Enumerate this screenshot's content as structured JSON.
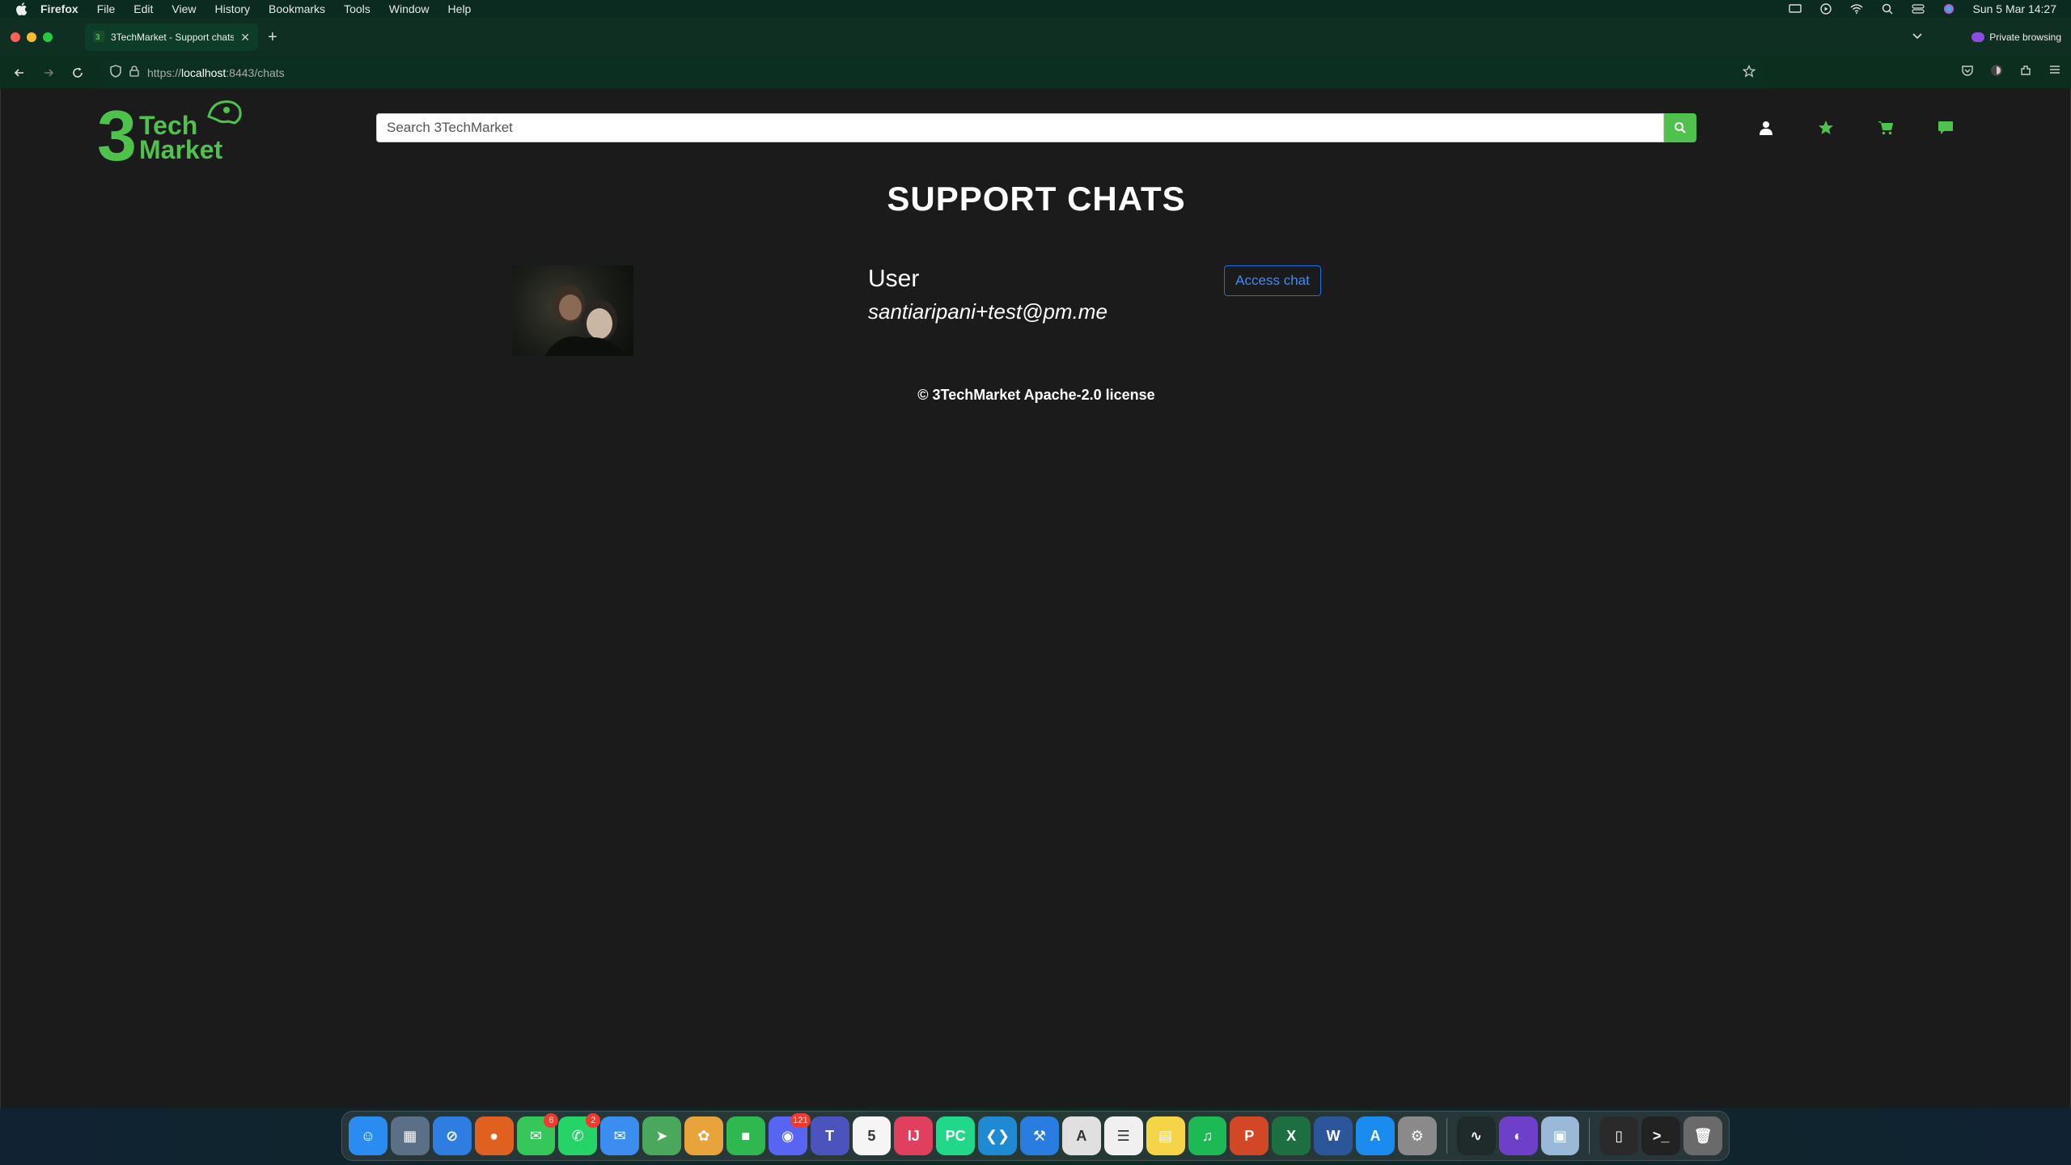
{
  "menubar": {
    "app": "Firefox",
    "items": [
      "File",
      "Edit",
      "View",
      "History",
      "Bookmarks",
      "Tools",
      "Window",
      "Help"
    ],
    "datetime": "Sun 5 Mar  14:27"
  },
  "browser": {
    "tab_title": "3TechMarket - Support chats",
    "private_label": "Private browsing",
    "url_prefix": "https://",
    "url_host": "localhost",
    "url_rest": ":8443/chats"
  },
  "header": {
    "logo_line1": "Tech",
    "logo_line2": "Market",
    "logo_digit": "3",
    "search_placeholder": "Search 3TechMarket",
    "brand_color": "#4ec24d"
  },
  "main": {
    "title": "SUPPORT CHATS",
    "chats": [
      {
        "name": "User",
        "email": "santiaripani+test@pm.me",
        "button": "Access chat"
      }
    ]
  },
  "footer": {
    "text": "© 3TechMarket Apache-2.0 license"
  },
  "dock": {
    "apps": [
      {
        "name": "finder",
        "color": "#2a8cf0",
        "glyph": "☺"
      },
      {
        "name": "launchpad",
        "color": "#5b6f86",
        "glyph": "▦"
      },
      {
        "name": "safari",
        "color": "#2f7de0",
        "glyph": "⊘"
      },
      {
        "name": "firefox",
        "color": "#e0601f",
        "glyph": "●"
      },
      {
        "name": "messages",
        "color": "#35c759",
        "glyph": "✉",
        "badge": "6"
      },
      {
        "name": "whatsapp",
        "color": "#25d366",
        "glyph": "✆",
        "badge": "2"
      },
      {
        "name": "mail",
        "color": "#3b8ef0",
        "glyph": "✉"
      },
      {
        "name": "maps",
        "color": "#4aa85c",
        "glyph": "➤"
      },
      {
        "name": "photos",
        "color": "#e8a33a",
        "glyph": "✿"
      },
      {
        "name": "facetime",
        "color": "#2fb84f",
        "glyph": "■"
      },
      {
        "name": "discord",
        "color": "#5865f2",
        "glyph": "◉",
        "badge": "121"
      },
      {
        "name": "teams",
        "color": "#4b53bc",
        "glyph": "T"
      },
      {
        "name": "calendar",
        "color": "#f5f5f5",
        "glyph": "5"
      },
      {
        "name": "intellij",
        "color": "#e0405e",
        "glyph": "IJ"
      },
      {
        "name": "pycharm",
        "color": "#21d789",
        "glyph": "PC"
      },
      {
        "name": "vscode",
        "color": "#1f8ad2",
        "glyph": "❮❯"
      },
      {
        "name": "xcode",
        "color": "#2a7de0",
        "glyph": "⚒"
      },
      {
        "name": "textedit",
        "color": "#e0e0e0",
        "glyph": "A"
      },
      {
        "name": "reminders",
        "color": "#f0f0f0",
        "glyph": "☰"
      },
      {
        "name": "notes",
        "color": "#f5d547",
        "glyph": "▤"
      },
      {
        "name": "spotify",
        "color": "#1db954",
        "glyph": "♫"
      },
      {
        "name": "powerpoint",
        "color": "#d24726",
        "glyph": "P"
      },
      {
        "name": "excel",
        "color": "#1d6f42",
        "glyph": "X"
      },
      {
        "name": "word",
        "color": "#2b579a",
        "glyph": "W"
      },
      {
        "name": "appstore",
        "color": "#1a8cf0",
        "glyph": "A"
      },
      {
        "name": "settings",
        "color": "#8a8a8a",
        "glyph": "⚙"
      },
      {
        "name": "activity-monitor",
        "color": "#1f2a2a",
        "glyph": "∿"
      },
      {
        "name": "github-desktop",
        "color": "#6e40c9",
        "glyph": "◐"
      },
      {
        "name": "preview",
        "color": "#9ab8d8",
        "glyph": "▣"
      },
      {
        "name": "document",
        "color": "#2a2a2a",
        "glyph": "▯"
      },
      {
        "name": "terminal",
        "color": "#222",
        "glyph": ">_"
      },
      {
        "name": "trash",
        "color": "#6a6a6a",
        "glyph": "🗑"
      }
    ]
  }
}
